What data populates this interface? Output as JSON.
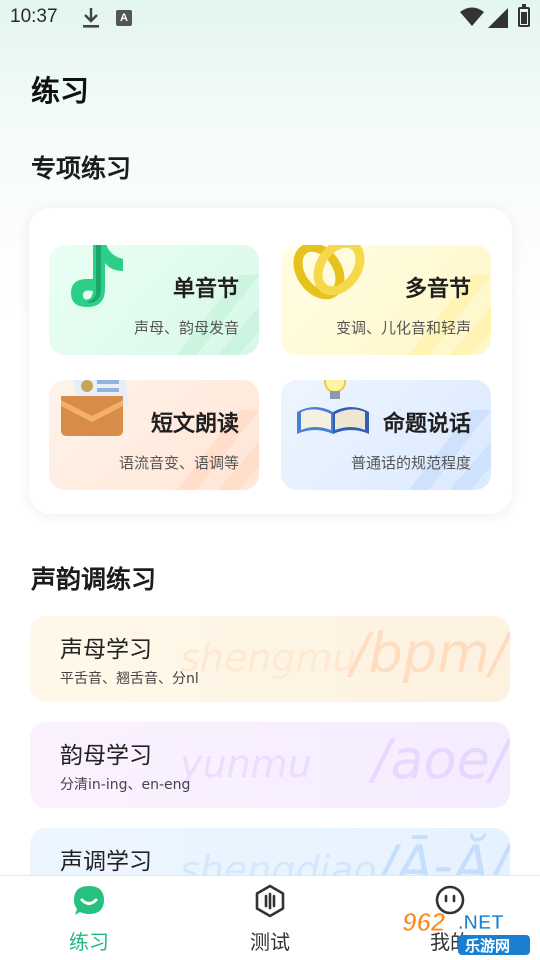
{
  "status_bar": {
    "time": "10:37",
    "icons": [
      "download-icon",
      "a-notification-icon",
      "wifi-icon",
      "signal-icon",
      "battery-icon"
    ]
  },
  "page_title": "练习",
  "special": {
    "title": "专项练习",
    "cards": [
      {
        "title": "单音节",
        "subtitle": "声母、韵母发音",
        "icon": "music-note-icon"
      },
      {
        "title": "多音节",
        "subtitle": "变调、儿化音和轻声",
        "icon": "chain-link-icon"
      },
      {
        "title": "短文朗读",
        "subtitle": "语流音变、语调等",
        "icon": "envelope-icon"
      },
      {
        "title": "命题说话",
        "subtitle": "普通话的规范程度",
        "icon": "book-bulb-icon"
      }
    ]
  },
  "tones": {
    "title": "声韵调练习",
    "rows": [
      {
        "title": "声母学习",
        "subtitle": "平舌音、翘舌音、分nl",
        "watermark": "shengmu",
        "big": "/bpm/"
      },
      {
        "title": "韵母学习",
        "subtitle": "分清in-ing、en-eng",
        "watermark": "yunmu",
        "big": "/aoe/"
      },
      {
        "title": "声调学习",
        "subtitle": "",
        "watermark": "shengdiao",
        "big": "/Ā-Ă/"
      }
    ]
  },
  "tabs": [
    {
      "label": "练习",
      "icon": "chat-bubble-icon",
      "active": true
    },
    {
      "label": "测试",
      "icon": "hexagon-test-icon",
      "active": false
    },
    {
      "label": "我的",
      "icon": "face-icon",
      "active": false
    }
  ],
  "watermark": {
    "brand": "962",
    "domain": ".NET",
    "site": "乐游网"
  },
  "colors": {
    "accent": "#22b87a"
  }
}
